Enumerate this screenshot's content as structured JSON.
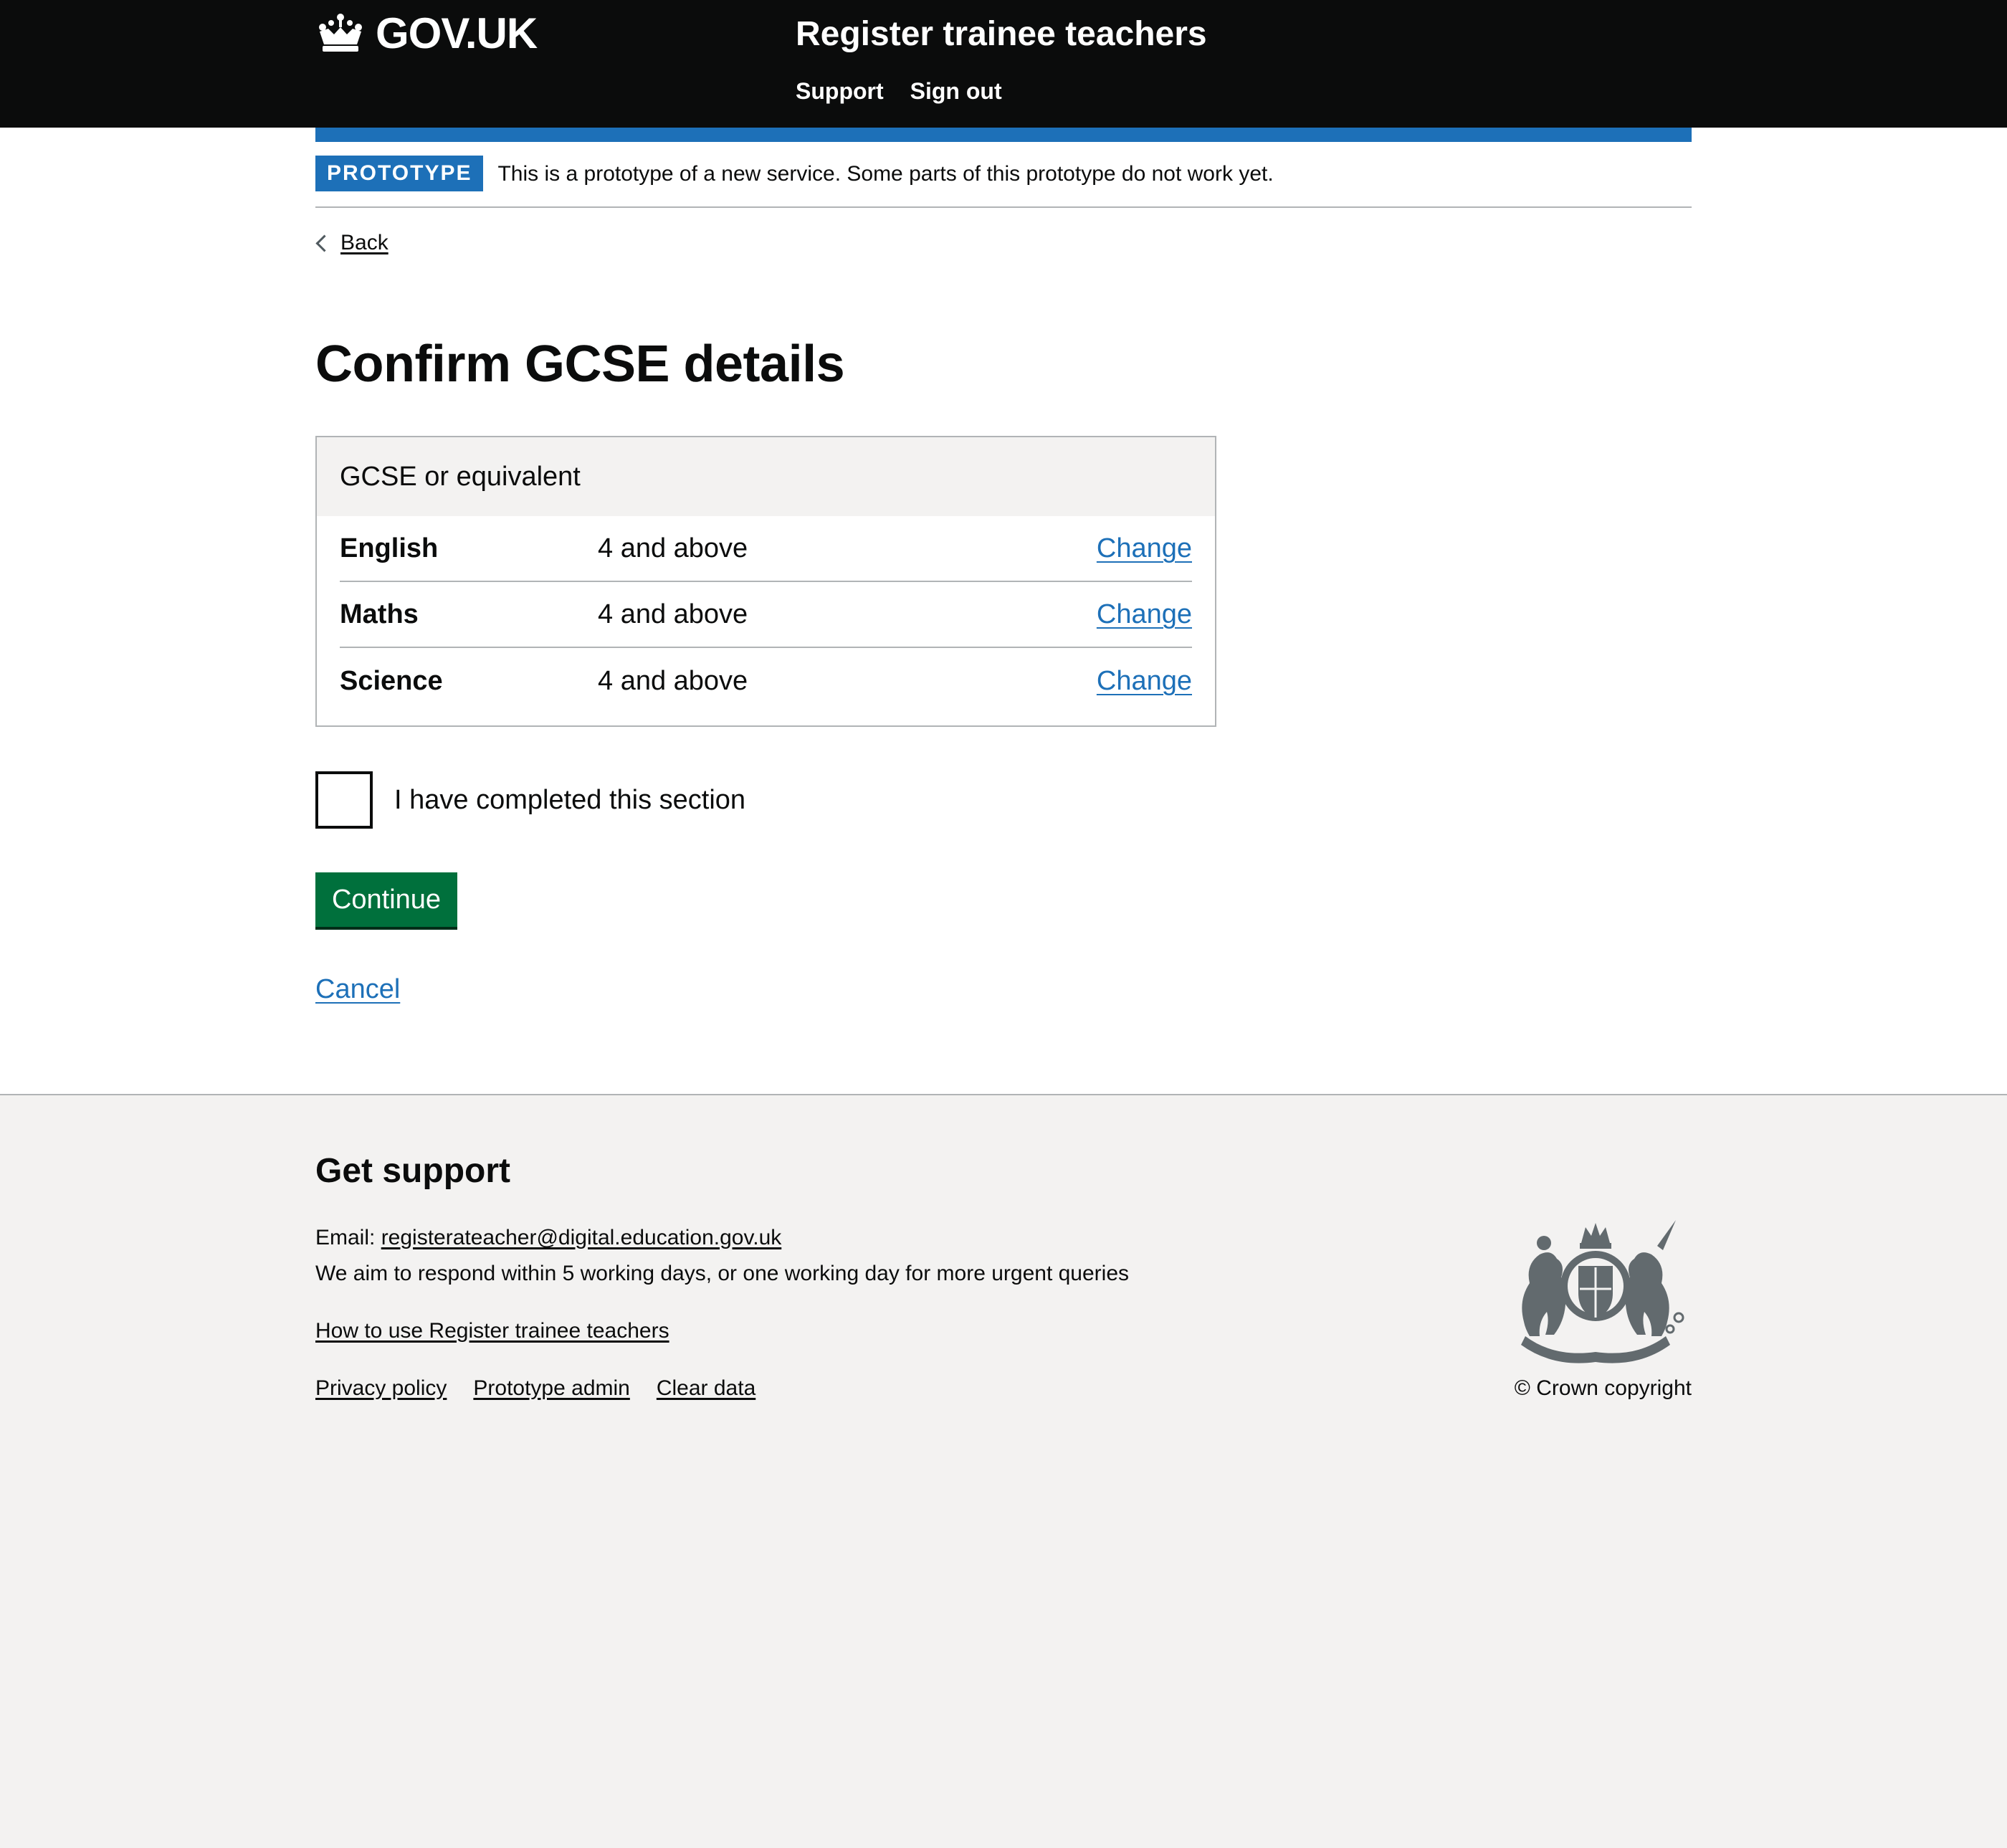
{
  "header": {
    "logo_text": "GOV.UK",
    "service_name": "Register trainee teachers",
    "nav": [
      {
        "label": "Support"
      },
      {
        "label": "Sign out"
      }
    ]
  },
  "phase_banner": {
    "tag": "PROTOTYPE",
    "text": "This is a prototype of a new service. Some parts of this prototype do not work yet."
  },
  "back_link": "Back",
  "page_title": "Confirm GCSE details",
  "summary_card": {
    "title": "GCSE or equivalent",
    "rows": [
      {
        "key": "English",
        "value": "4 and above",
        "action": "Change"
      },
      {
        "key": "Maths",
        "value": "4 and above",
        "action": "Change"
      },
      {
        "key": "Science",
        "value": "4 and above",
        "action": "Change"
      }
    ]
  },
  "completed_checkbox": {
    "label": "I have completed this section",
    "checked": false
  },
  "continue_button": "Continue",
  "cancel_link": "Cancel",
  "footer": {
    "heading": "Get support",
    "email_prefix": "Email: ",
    "email": "registerateacher@digital.education.gov.uk",
    "respond_text": "We aim to respond within 5 working days, or one working day for more urgent queries",
    "how_to_link": "How to use Register trainee teachers",
    "meta_links": [
      {
        "label": "Privacy policy"
      },
      {
        "label": "Prototype admin"
      },
      {
        "label": "Clear data"
      }
    ],
    "crest_icon": "royal-coat-of-arms-icon",
    "copyright": "© Crown copyright"
  },
  "colors": {
    "header_bg": "#0b0c0c",
    "brand_blue": "#1d70b8",
    "link_blue": "#1d70b8",
    "button_green": "#00703c",
    "footer_bg": "#f3f2f1",
    "border_grey": "#b1b4b6"
  }
}
